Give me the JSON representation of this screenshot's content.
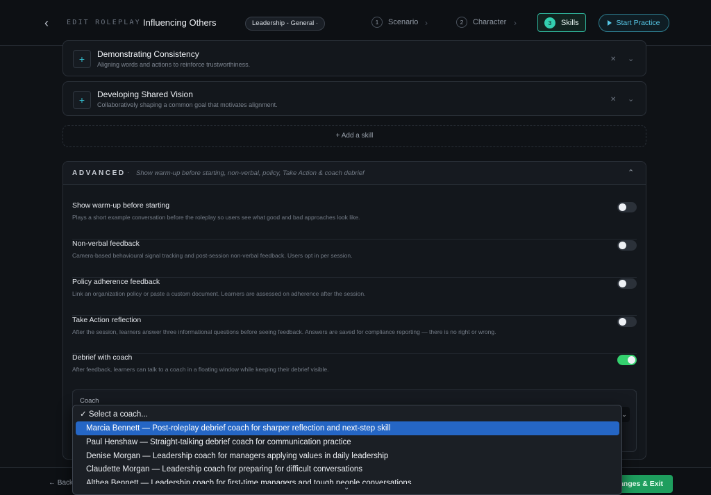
{
  "header": {
    "back_icon": "chevron-left-icon",
    "kicker": "EDIT ROLEPLAY",
    "kicker_sep": "·",
    "title": "Influencing Others",
    "category": "Leadership - General ·",
    "steps": [
      {
        "num": "1",
        "label": "Scenario"
      },
      {
        "num": "2",
        "label": "Character"
      },
      {
        "num": "3",
        "label": "Skills"
      }
    ],
    "start_label": "Start Practice"
  },
  "skills": [
    {
      "title": "Demonstrating Consistency",
      "desc": "Aligning words and actions to reinforce trustworthiness."
    },
    {
      "title": "Developing Shared Vision",
      "desc": "Collaboratively shaping a common goal that motivates alignment."
    }
  ],
  "add_skill": "+ Add a skill",
  "advanced": {
    "label": "ADVANCED",
    "summary": "Show warm-up before starting, non-verbal, policy, Take Action & coach debrief",
    "options": [
      {
        "title": "Show warm-up before starting",
        "desc": "Plays a short example conversation before the roleplay so users see what good and bad approaches look like.",
        "enabled": false
      },
      {
        "title": "Non-verbal feedback",
        "desc": "Camera-based behavioural signal tracking and post-session non-verbal feedback. Users opt in per session.",
        "enabled": false
      },
      {
        "title": "Policy adherence feedback",
        "desc": "Link an organization policy or paste a custom document. Learners are assessed on adherence after the session.",
        "enabled": false
      },
      {
        "title": "Take Action reflection",
        "desc": "After the session, learners answer three informational questions before seeing feedback. Answers are saved for compliance reporting — there is no right or wrong.",
        "enabled": false
      },
      {
        "title": "Debrief with coach",
        "desc": "After feedback, learners can talk to a coach in a floating window while keeping their debrief visible.",
        "enabled": true
      }
    ],
    "coach_label": "Coach"
  },
  "coach_dropdown": {
    "options": [
      "✓ Select a coach...",
      "Marcia Bennett — Post-roleplay debrief coach for sharper reflection and next-step skill",
      "Paul Henshaw — Straight-talking debrief coach for communication practice",
      "Denise Morgan — Leadership coach for managers applying values in daily leadership",
      "Claudette Morgan — Leadership coach for preparing for difficult conversations",
      "Althea Bennett — Leadership coach for first-time managers and tough people conversations"
    ],
    "highlighted_index": 1
  },
  "footer": {
    "back_label": "← Back",
    "save_label": "Changes & Exit"
  },
  "colors": {
    "accent_teal": "#33d0b0",
    "toggle_on": "#34d16e",
    "highlight": "#2566c5"
  }
}
